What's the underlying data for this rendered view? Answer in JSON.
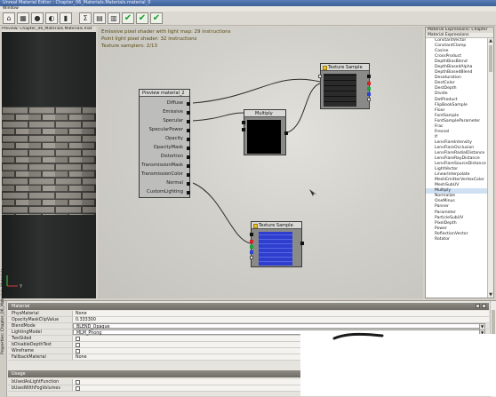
{
  "window": {
    "title": "Unreal Material Editor : Chapter_06_Materials.Materials.material_0",
    "menu": "Window"
  },
  "toolbar": {
    "buttons": [
      {
        "name": "home-icon",
        "glyph": "⌂"
      },
      {
        "name": "grid-icon",
        "glyph": "▦"
      },
      {
        "name": "sphere-icon",
        "glyph": "●"
      },
      {
        "name": "sphere-icon-2",
        "glyph": "◐"
      },
      {
        "name": "cylinder-icon",
        "glyph": "▮"
      },
      {
        "name": "expression-icon",
        "glyph": "Σ"
      },
      {
        "name": "stats-icon",
        "glyph": "▤"
      },
      {
        "name": "filter-icon",
        "glyph": "▥"
      }
    ],
    "checks": [
      "✔",
      "✔",
      "✔"
    ],
    "check_color": "#1a9a2a"
  },
  "preview": {
    "label": "Preview: Chapter_06_Materials.Materials.mat"
  },
  "stats": {
    "line1": "Emissive pixel shader with light map: 29 instructions",
    "line2": "Point light pixel shader: 32 instructions",
    "line3": "Texture samplers: 2/13"
  },
  "nodes": {
    "material": {
      "title": "Preview material_2",
      "inputs": [
        "Diffuse",
        "Emissive",
        "Specular",
        "SpecularPower",
        "Opacity",
        "OpacityMask",
        "Distortion",
        "TransmissionMask",
        "TransmissionColor",
        "Normal",
        "CustomLighting"
      ]
    },
    "texture_top": {
      "title": "Texture Sample"
    },
    "multiply": {
      "title": "Multiply"
    },
    "texture_bottom": {
      "title": "Texture Sample"
    }
  },
  "expressions": {
    "window_title": "Material Expressions: Chapter",
    "tab": "Material Expressions",
    "items": [
      "ConstantVector",
      "ConstantClamp",
      "Cosine",
      "CrossProduct",
      "DepthBiasBlend",
      "DepthBiasedAlpha",
      "DepthBiasedBlend",
      "Desaturation",
      "DestColor",
      "DestDepth",
      "Divide",
      "DotProduct",
      "FlipBookSample",
      "Floor",
      "FontSample",
      "FontSampleParameter",
      "Frac",
      "Fresnel",
      "If",
      "LensFlareIntensity",
      "LensFlareOcclusion",
      "LensFlareRadialDistance",
      "LensFlareRayDistance",
      "LensFlareSourceDistance",
      "LightVector",
      "LinearInterpolate",
      "MeshEmitterVertexColor",
      "MeshSubUV",
      "Multiply",
      "Normalize",
      "OneMinus",
      "Panner",
      "Parameter",
      "ParticleSubUV",
      "PixelDepth",
      "Power",
      "ReflectionVector",
      "Rotator"
    ],
    "selected": "Multiply",
    "selected_color": "#cfe0f3"
  },
  "properties": {
    "side_label": "Properties: Chapter_06_Materials.Materials",
    "material_category": "Material",
    "usage_category": "Usage",
    "rows": [
      {
        "name": "PhysMaterial",
        "value": "None",
        "type": "text"
      },
      {
        "name": "OpacityMaskClipValue",
        "value": "0.333300",
        "type": "text"
      },
      {
        "name": "BlendMode",
        "value": "BLEND_Opaque",
        "type": "combo"
      },
      {
        "name": "LightingModel",
        "value": "MLM_Phong",
        "type": "combo"
      },
      {
        "name": "TwoSided",
        "value": "",
        "type": "check"
      },
      {
        "name": "bDisableDepthTest",
        "value": "",
        "type": "check"
      },
      {
        "name": "Wireframe",
        "value": "",
        "type": "check"
      },
      {
        "name": "FallbackMaterial",
        "value": "None",
        "type": "text"
      }
    ],
    "usage_rows": [
      {
        "name": "bUsedAsLightFunction",
        "value": "",
        "type": "check"
      },
      {
        "name": "bUsedWithFogVolumes",
        "value": "",
        "type": "check"
      }
    ]
  },
  "colors": {
    "canvas": "#d1d0ca",
    "node_header": "#d9d9d6",
    "wire": "#2d2d2d",
    "category_bar": "#7f7c76"
  }
}
